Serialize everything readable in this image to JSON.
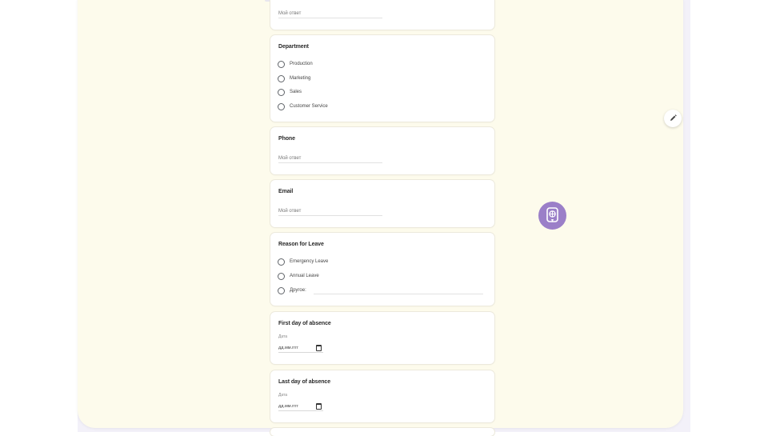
{
  "form": {
    "answer_placeholder": "Мой ответ",
    "department": {
      "title": "Department",
      "options": [
        "Production",
        "Marketing",
        "Sales",
        "Customer Service"
      ]
    },
    "phone": {
      "title": "Phone",
      "placeholder": "Мой ответ"
    },
    "email": {
      "title": "Email",
      "placeholder": "Мой ответ"
    },
    "reason": {
      "title": "Reason for Leave",
      "options": [
        "Emergency Leave",
        "Annual Leave",
        "Другое:"
      ]
    },
    "first_day": {
      "title": "First day of absence",
      "sub_label": "Дата",
      "placeholder": "дд.мм.гггг"
    },
    "last_day": {
      "title": "Last day of absence",
      "sub_label": "Дата",
      "placeholder": "дд.мм.гггг"
    }
  },
  "colors": {
    "canvas": "#fdfbec",
    "backdrop": "#f3f1f9",
    "accent": "#9b7fc8"
  },
  "icons": {
    "edit": "pencil-icon",
    "badge": "ai-chip-icon",
    "calendar": "calendar-icon"
  }
}
